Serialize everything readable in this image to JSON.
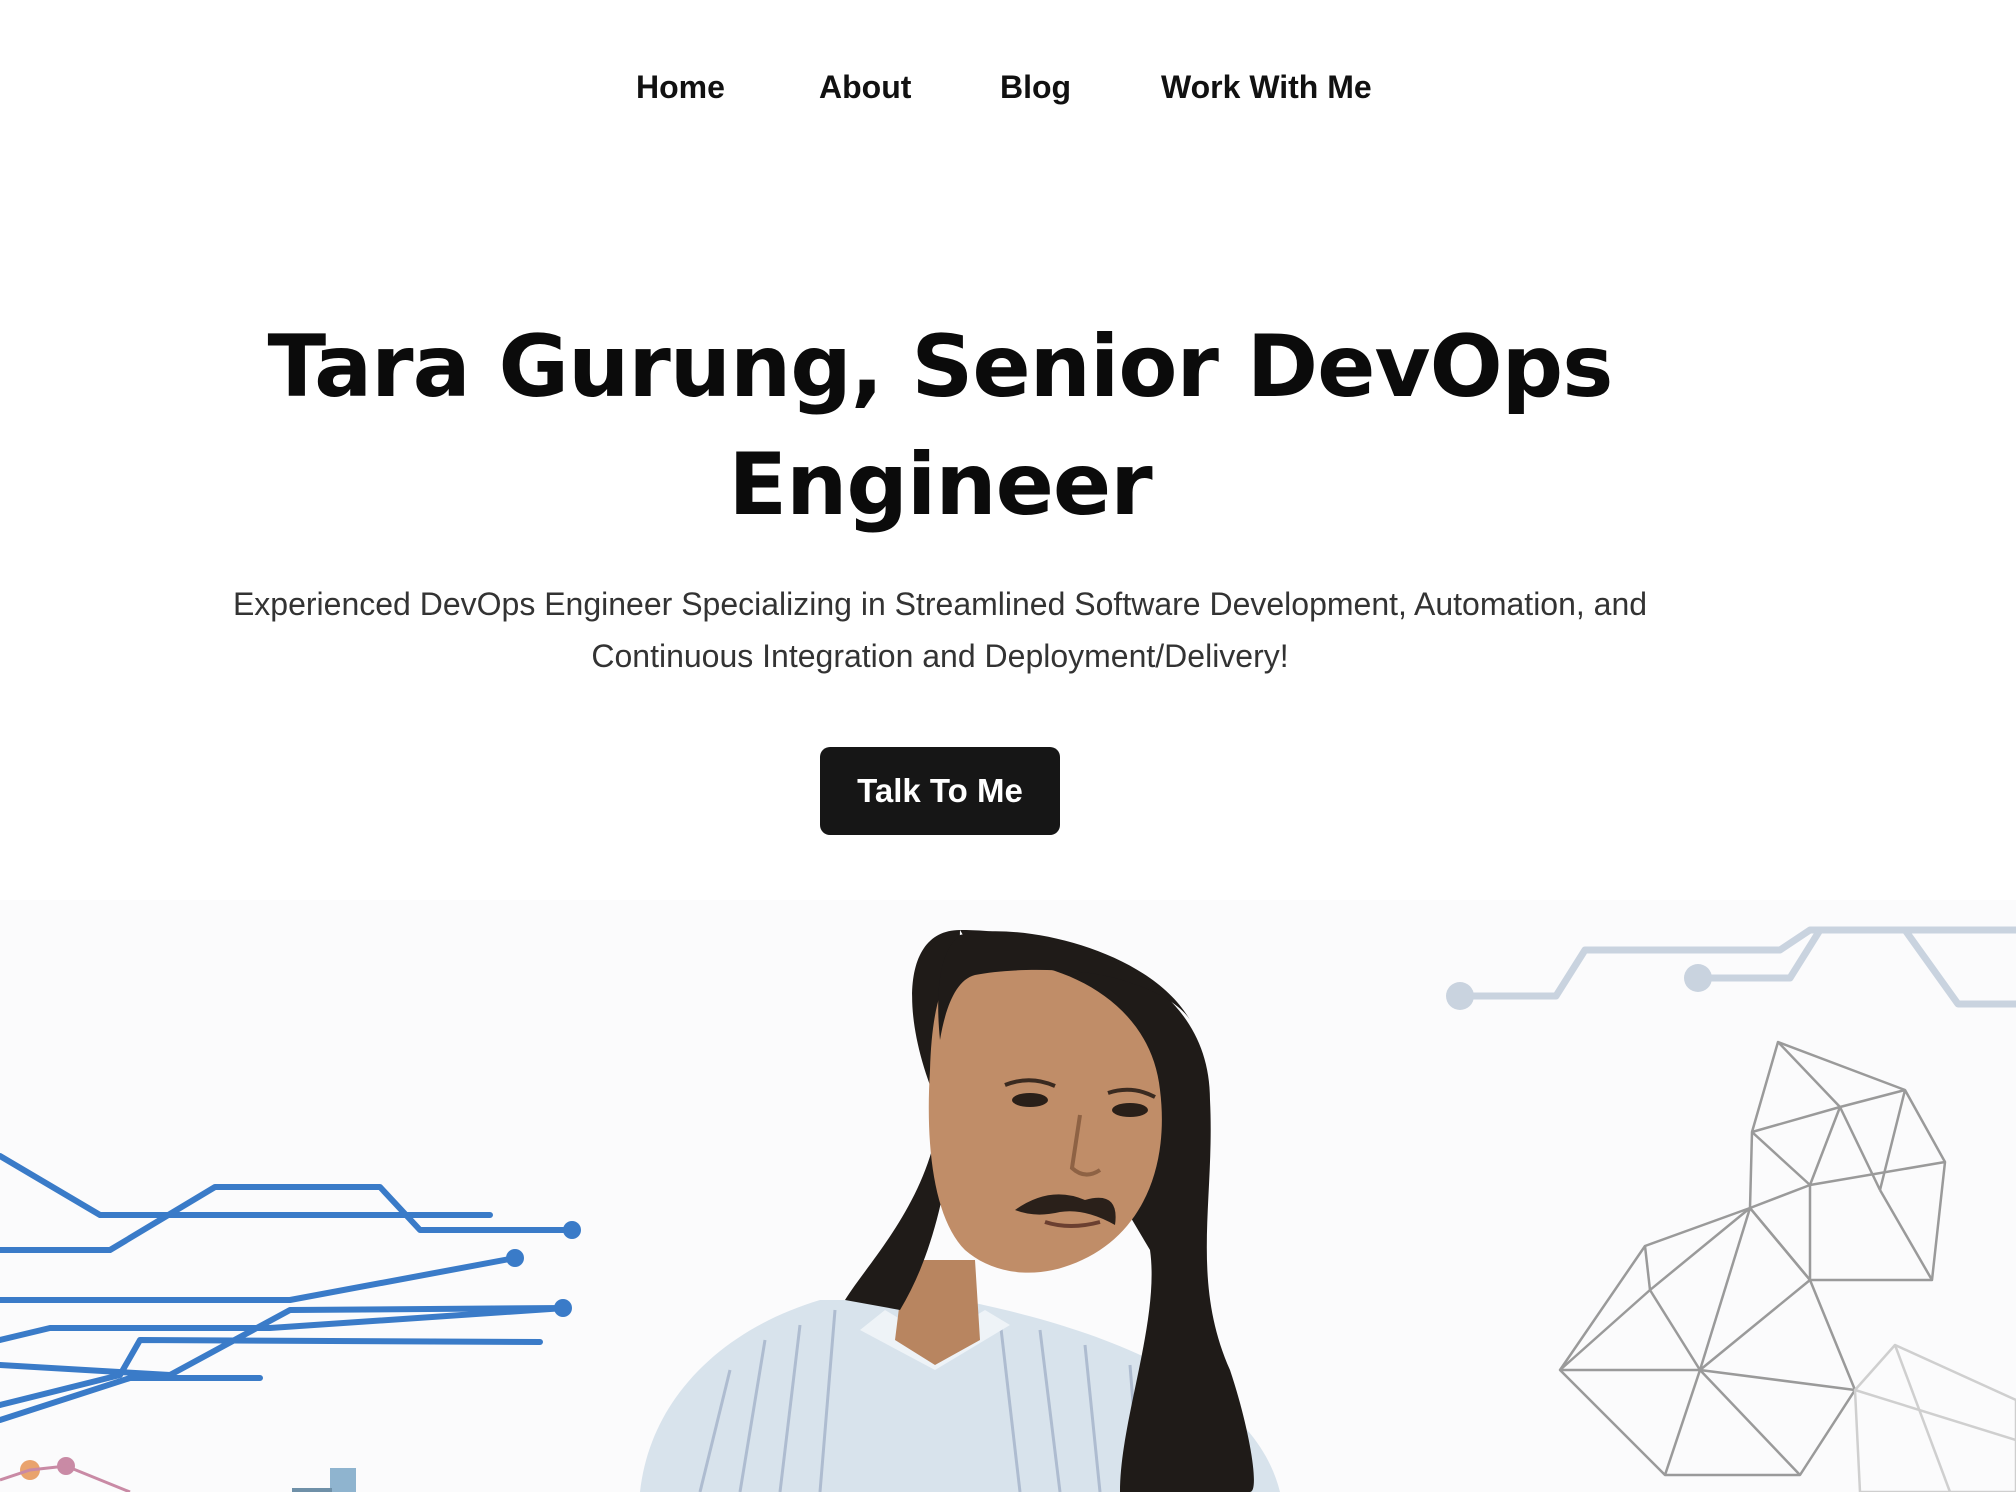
{
  "nav": {
    "items": [
      {
        "label": "Home"
      },
      {
        "label": "About"
      },
      {
        "label": "Blog"
      },
      {
        "label": "Work With Me"
      }
    ]
  },
  "hero": {
    "title": "Tara Gurung, Senior DevOps Engineer",
    "subtitle": "Experienced DevOps Engineer Specializing in Streamlined Software Development, Automation, and Continuous Integration and Deployment/Delivery!",
    "cta_label": "Talk To Me"
  },
  "colors": {
    "text": "#111111",
    "button_bg": "#161616",
    "button_text": "#ffffff",
    "circuit_blue": "#3a7bc8",
    "circuit_grey": "#c9d3df",
    "mesh_grey": "#9a9a9a"
  },
  "icons": {
    "circuit_left": "circuit-lines-graphic",
    "circuit_right": "circuit-lines-graphic",
    "mesh": "polygon-mesh-graphic"
  }
}
